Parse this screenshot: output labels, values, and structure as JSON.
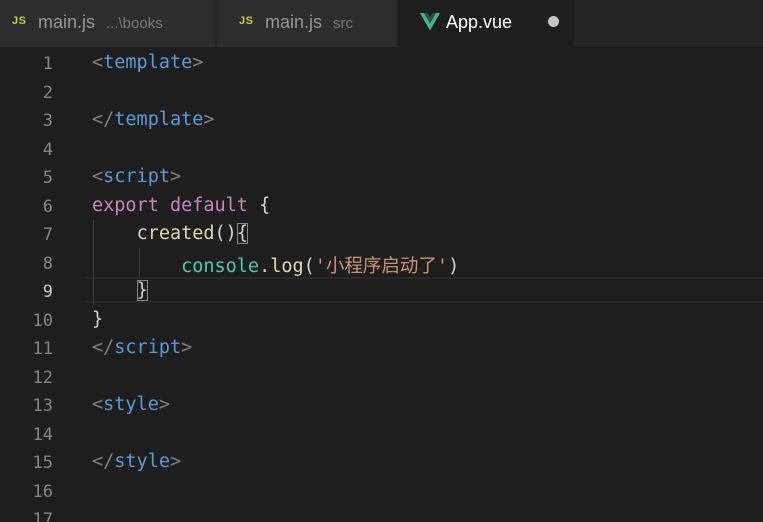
{
  "tabs": [
    {
      "icon": "js-icon",
      "icon_text": "JS",
      "label": "main.js",
      "description": "...\\books",
      "active": false
    },
    {
      "icon": "js-icon",
      "icon_text": "JS",
      "label": "main.js",
      "description": "src",
      "active": false
    },
    {
      "icon": "vue-icon",
      "label": "App.vue",
      "dirty": true,
      "active": true
    }
  ],
  "colors": {
    "background": "#1e1e1e",
    "tag": "#569cd6",
    "keyword": "#c586c0",
    "function": "#dcdcaa",
    "class": "#4ec9b0",
    "string": "#ce9178",
    "punctuation": "#808080",
    "vue_green": "#41b883"
  },
  "editor": {
    "current_line": 9,
    "line_numbers": [
      "1",
      "2",
      "3",
      "4",
      "5",
      "6",
      "7",
      "8",
      "9",
      "10",
      "11",
      "12",
      "13",
      "14",
      "15",
      "16",
      "17"
    ],
    "code": {
      "l1": {
        "open": "<",
        "tag": "template",
        "close": ">"
      },
      "l3": {
        "open": "</",
        "tag": "template",
        "close": ">"
      },
      "l5": {
        "open": "<",
        "tag": "script",
        "close": ">"
      },
      "l6": {
        "kw1": "export",
        "kw2": "default",
        "brace": "{"
      },
      "l7": {
        "fn": "created",
        "parens": "()",
        "brace": "{"
      },
      "l8": {
        "obj": "console",
        "dot": ".",
        "method": "log",
        "open": "(",
        "str": "'小程序启动了'",
        "close": ")"
      },
      "l9": {
        "brace": "}"
      },
      "l10": {
        "brace": "}"
      },
      "l11": {
        "open": "</",
        "tag": "script",
        "close": ">"
      },
      "l13": {
        "open": "<",
        "tag": "style",
        "close": ">"
      },
      "l15": {
        "open": "</",
        "tag": "style",
        "close": ">"
      }
    }
  }
}
